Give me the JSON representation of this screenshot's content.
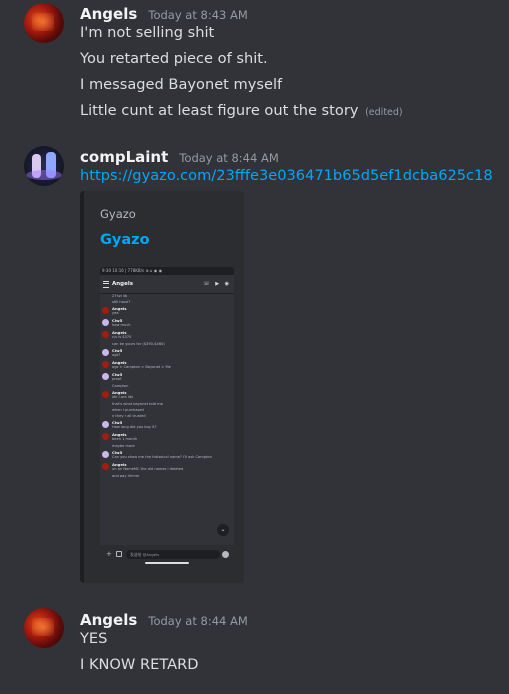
{
  "messages": [
    {
      "username": "Angels",
      "timestamp": "Today at 8:43 AM",
      "lines": [
        "I'm not selling shit",
        "You retarted piece of shit.",
        "I messaged Bayonet myself",
        "Little cunt at least figure out the story"
      ],
      "edited_label": "(edited)"
    },
    {
      "username": "compLaint",
      "timestamp": "Today at 8:44 AM",
      "link": "https://gyazo.com/23fffe3e036471b65d5ef1dcba625c18",
      "embed": {
        "provider": "Gyazo",
        "title": "Gyazo",
        "screenshot": {
          "status_bar": "9:30 10:16 | 778KB/s ⊕ ⌂ ◉ ◉",
          "channel_name": "Angels",
          "input_placeholder": "发送给 @Angels",
          "rows": [
            {
              "name": "",
              "text": "27hzl lib"
            },
            {
              "name": "",
              "text": "still have?"
            },
            {
              "name": "Angels",
              "text": "yea"
            },
            {
              "name": "Clw5",
              "text": "how much"
            },
            {
              "name": "Angels",
              "text": "c/s is $370"
            },
            {
              "name": "",
              "text": "can be yours for ($390-$460)"
            },
            {
              "name": "Clw5",
              "text": "ogs?"
            },
            {
              "name": "Angels",
              "text": "ogs > Campton > Bayonet > Me"
            },
            {
              "name": "Clw5",
              "text": "proof"
            },
            {
              "name": "",
              "text": "Campton"
            },
            {
              "name": "Angels",
              "text": "idk I-ont idk"
            },
            {
              "name": "",
              "text": "that's what bayonet told me"
            },
            {
              "name": "",
              "text": "when I purchased"
            },
            {
              "name": "",
              "text": "n they r all trusted"
            },
            {
              "name": "Clw5",
              "text": "How long did you buy it?"
            },
            {
              "name": "Angels",
              "text": "been 1 month"
            },
            {
              "name": "",
              "text": "maybe more"
            },
            {
              "name": "Clw5",
              "text": "Can you show me the historical name? I'll ask Campton"
            },
            {
              "name": "Angels",
              "text": "uh on NameMC the old names i deleted"
            },
            {
              "name": "",
              "text": "and pay hhmm"
            }
          ]
        }
      }
    },
    {
      "username": "Angels",
      "timestamp": "Today at 8:44 AM",
      "lines": [
        "YES",
        "I KNOW RETARD"
      ]
    }
  ]
}
